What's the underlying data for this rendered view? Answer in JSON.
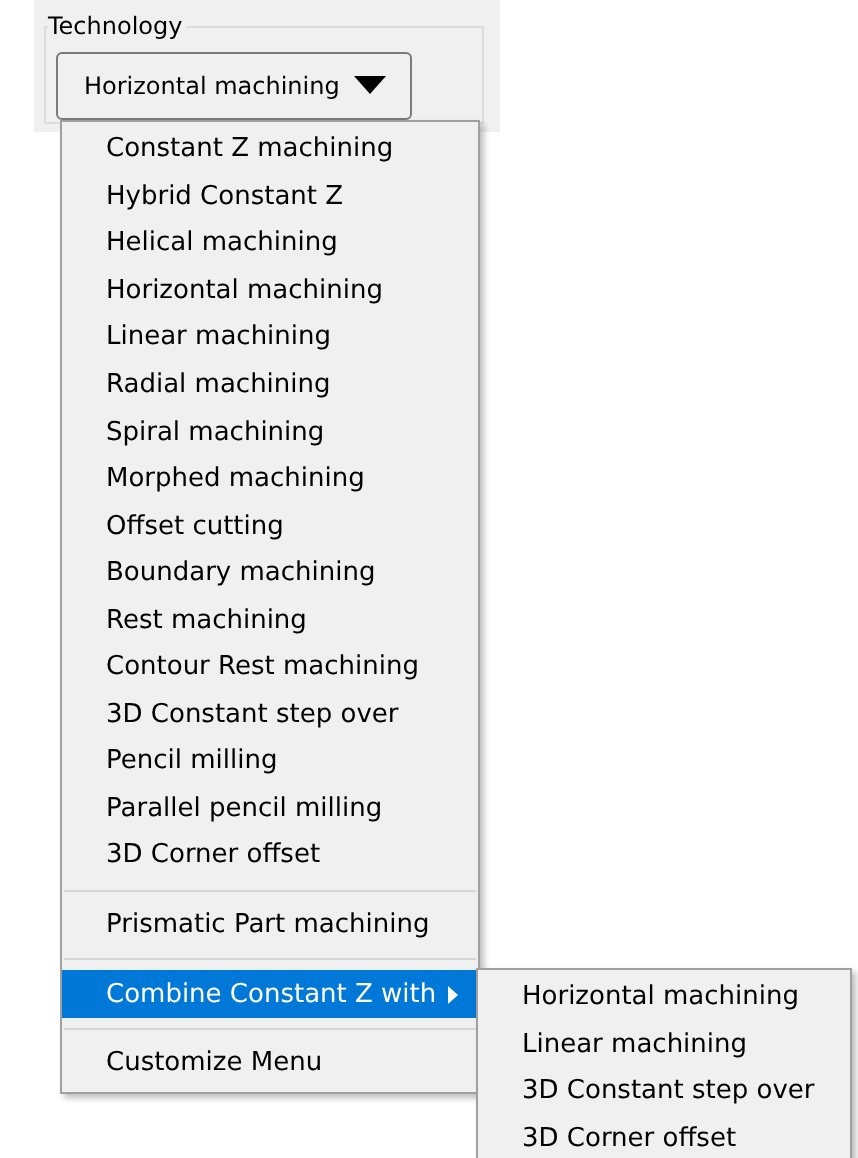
{
  "group": {
    "label": "Technology"
  },
  "combo": {
    "value": "Horizontal machining"
  },
  "menu": {
    "groups": [
      [
        {
          "label": "Constant Z machining",
          "selected": false,
          "submenu": false
        },
        {
          "label": "Hybrid Constant Z",
          "selected": false,
          "submenu": false
        },
        {
          "label": "Helical machining",
          "selected": false,
          "submenu": false
        },
        {
          "label": "Horizontal machining",
          "selected": false,
          "submenu": false
        },
        {
          "label": "Linear machining",
          "selected": false,
          "submenu": false
        },
        {
          "label": "Radial machining",
          "selected": false,
          "submenu": false
        },
        {
          "label": "Spiral machining",
          "selected": false,
          "submenu": false
        },
        {
          "label": "Morphed machining",
          "selected": false,
          "submenu": false
        },
        {
          "label": "Offset cutting",
          "selected": false,
          "submenu": false
        },
        {
          "label": "Boundary machining",
          "selected": false,
          "submenu": false
        },
        {
          "label": "Rest machining",
          "selected": false,
          "submenu": false
        },
        {
          "label": "Contour Rest machining",
          "selected": false,
          "submenu": false
        },
        {
          "label": "3D Constant step over",
          "selected": false,
          "submenu": false
        },
        {
          "label": "Pencil milling",
          "selected": false,
          "submenu": false
        },
        {
          "label": "Parallel pencil milling",
          "selected": false,
          "submenu": false
        },
        {
          "label": "3D Corner offset",
          "selected": false,
          "submenu": false
        }
      ],
      [
        {
          "label": "Prismatic Part machining",
          "selected": false,
          "submenu": false
        }
      ],
      [
        {
          "label": "Combine Constant Z with",
          "selected": true,
          "submenu": true
        }
      ],
      [
        {
          "label": "Customize Menu",
          "selected": false,
          "submenu": false
        }
      ]
    ]
  },
  "submenu": {
    "items": [
      {
        "label": "Horizontal machining",
        "selected": false
      },
      {
        "label": "Linear machining",
        "selected": false
      },
      {
        "label": "3D Constant step over",
        "selected": false
      },
      {
        "label": "3D Corner offset",
        "selected": false
      }
    ]
  }
}
